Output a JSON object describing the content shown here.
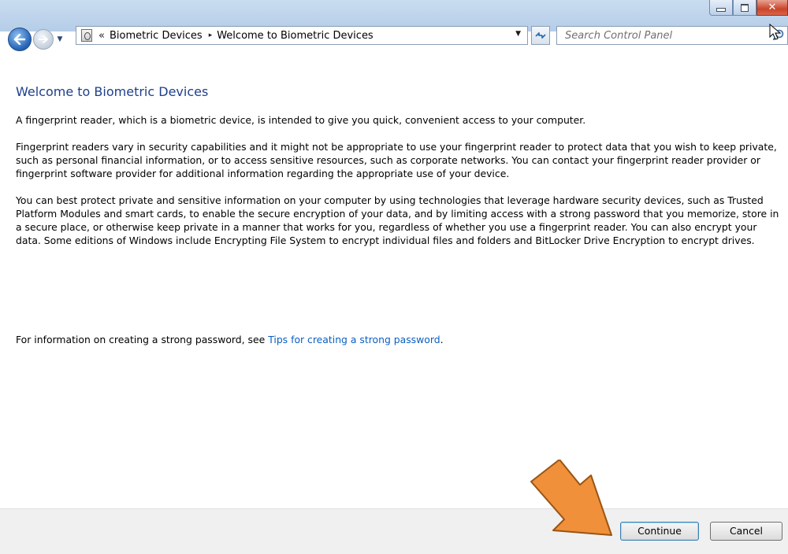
{
  "navigation": {
    "breadcrumb_prefix": "«",
    "breadcrumbs": [
      "Biometric Devices",
      "Welcome to Biometric Devices"
    ],
    "separator": "▸"
  },
  "search": {
    "placeholder": "Search Control Panel"
  },
  "content": {
    "title": "Welcome to Biometric Devices",
    "paragraphs": [
      "A fingerprint reader, which is a biometric device, is intended to give you quick, convenient access to your computer.",
      "Fingerprint readers vary in security capabilities and it might not be appropriate to use your fingerprint reader to protect data that you wish to keep private, such as personal financial information, or to access sensitive resources, such as corporate networks. You can contact your fingerprint reader provider or fingerprint software provider for additional information regarding the appropriate use of your device.",
      "You can best protect private and sensitive information on your computer by using technologies that leverage hardware security devices, such as Trusted Platform Modules and smart cards, to enable the secure encryption of your data, and by limiting access with a strong password that you memorize, store in a secure place, or otherwise keep private in a manner that works for you, regardless of whether you use a fingerprint reader. You can also encrypt your data. Some editions of Windows include Encrypting File System to encrypt individual files and folders and BitLocker Drive Encryption to encrypt drives."
    ],
    "tip_prefix": "For information on creating a strong password, see ",
    "tip_link": "Tips for creating a strong password",
    "tip_suffix": "."
  },
  "buttons": {
    "continue_label": "Continue",
    "cancel_label": "Cancel"
  },
  "colors": {
    "title": "#1e3f8c",
    "link": "#0a5fc2",
    "annotation_arrow": "#f0903a"
  },
  "icons": {
    "back": "back-arrow-icon",
    "forward": "forward-arrow-icon",
    "control_panel": "fingerprint-icon",
    "refresh": "refresh-icon",
    "search": "search-icon"
  }
}
